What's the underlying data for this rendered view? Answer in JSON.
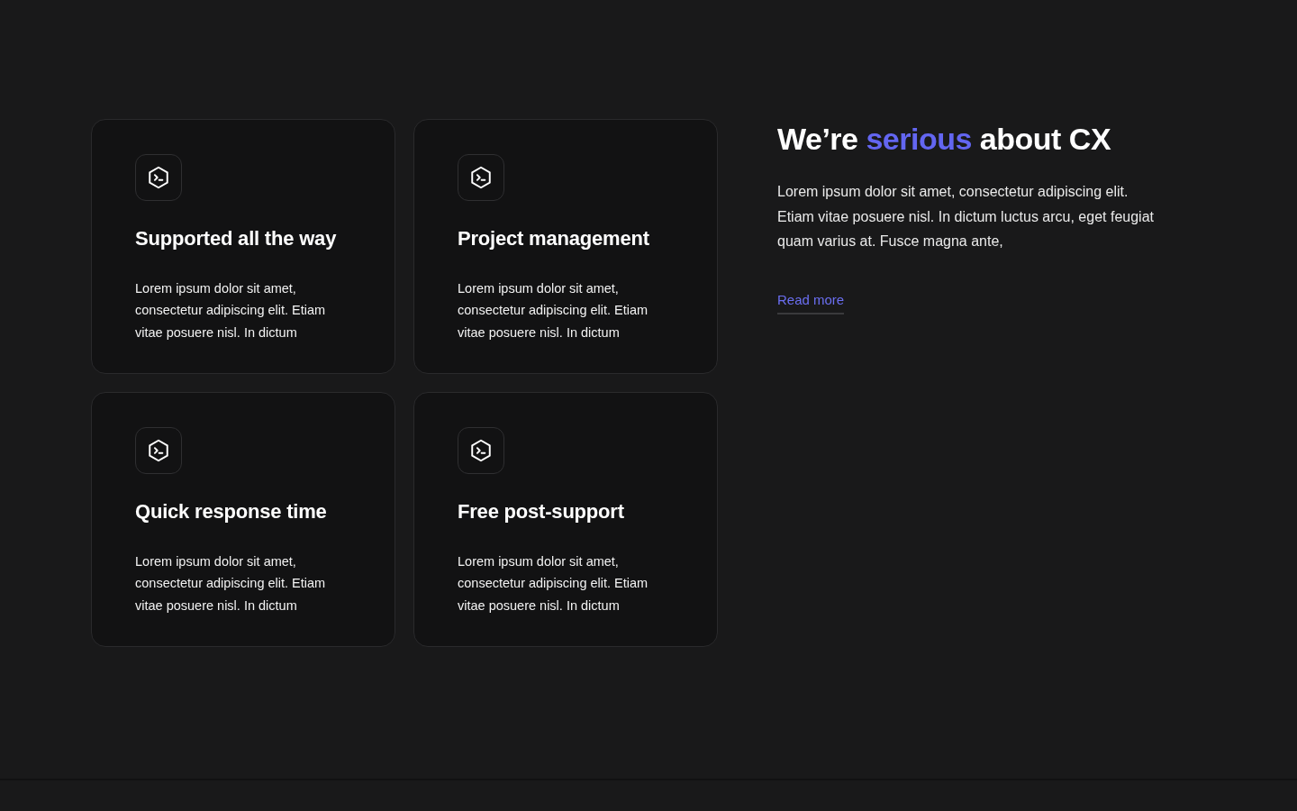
{
  "features": [
    {
      "title": "Supported all the way",
      "description": "Lorem ipsum dolor sit amet, consectetur adipiscing elit. Etiam vitae posuere nisl. In dictum"
    },
    {
      "title": "Project management",
      "description": "Lorem ipsum dolor sit amet, consectetur adipiscing elit. Etiam vitae posuere nisl. In dictum"
    },
    {
      "title": "Quick response time",
      "description": "Lorem ipsum dolor sit amet, consectetur adipiscing elit. Etiam vitae posuere nisl. In dictum"
    },
    {
      "title": "Free post-support",
      "description": "Lorem ipsum dolor sit amet, consectetur adipiscing elit. Etiam vitae posuere nisl. In dictum"
    }
  ],
  "intro": {
    "heading": [
      {
        "text": "We’re",
        "accent": false
      },
      {
        "text": "serious",
        "accent": true
      },
      {
        "text": "about CX",
        "accent": false
      }
    ],
    "body": "Lorem ipsum dolor sit amet, consectetur adipiscing elit. Etiam vitae posuere nisl. In dictum luctus arcu, eget feugiat quam varius at. Fusce magna ante,",
    "link": "Read more"
  }
}
